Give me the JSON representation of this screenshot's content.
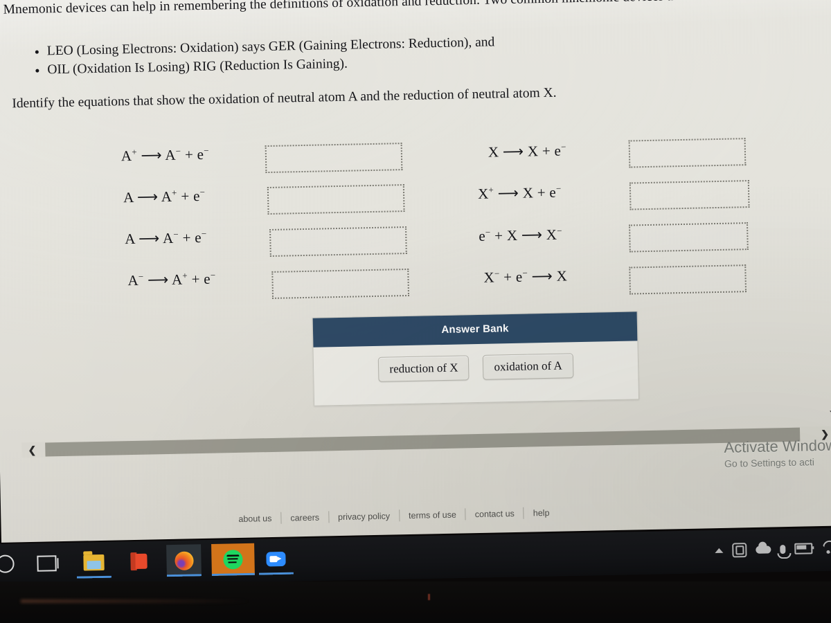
{
  "lesson": {
    "intro": "Mnemonic devices can help in remembering the definitions of oxidation and reduction. Two common mnemonic devices a",
    "bullets": [
      "LEO (Losing Electrons: Oxidation) says GER (Gaining Electrons: Reduction), and",
      "OIL (Oxidation Is Losing) RIG (Reduction Is Gaining)."
    ],
    "instruction": "Identify the equations that show the oxidation of neutral atom A and the reduction of neutral atom X."
  },
  "equations": {
    "left_column": [
      {
        "id": "eq-a1",
        "text": "A⁺ ⟶ A⁻ + e⁻",
        "drop_value": ""
      },
      {
        "id": "eq-a2",
        "text": "A ⟶ A⁺ + e⁻",
        "drop_value": ""
      },
      {
        "id": "eq-a3",
        "text": "A ⟶ A⁻ + e⁻",
        "drop_value": ""
      },
      {
        "id": "eq-a4",
        "text": "A⁻ ⟶ A⁺ + e⁻",
        "drop_value": ""
      }
    ],
    "right_column": [
      {
        "id": "eq-x1",
        "text": "X ⟶ X + e⁻",
        "drop_value": ""
      },
      {
        "id": "eq-x2",
        "text": "X⁺ ⟶ X + e⁻",
        "drop_value": ""
      },
      {
        "id": "eq-x3",
        "text": "e⁻ + X ⟶ X⁻",
        "drop_value": ""
      },
      {
        "id": "eq-x4",
        "text": "X⁻ + e⁻ ⟶ X",
        "drop_value": ""
      }
    ]
  },
  "answer_bank": {
    "title": "Answer Bank",
    "header_color": "#2e4a66",
    "tiles": [
      {
        "label": "reduction of X"
      },
      {
        "label": "oxidation of A"
      }
    ]
  },
  "scrollbars": {
    "left_arrow": "❮",
    "right_arrow": "❯",
    "down_chevron": "⌄"
  },
  "watermark": {
    "line1": "Activate Window",
    "line2": "Go to Settings to acti"
  },
  "footer": {
    "links": [
      "about us",
      "careers",
      "privacy policy",
      "terms of use",
      "contact us",
      "help"
    ]
  },
  "taskbar": {
    "items": [
      {
        "name": "cortana-icon",
        "icon": "ic-cortana",
        "active": false
      },
      {
        "name": "task-view-icon",
        "icon": "ic-taskview",
        "active": false
      },
      {
        "name": "file-explorer-icon",
        "icon": "ic-folder",
        "active": true
      },
      {
        "name": "office-icon",
        "icon": "ic-office",
        "active": false
      },
      {
        "name": "firefox-icon",
        "icon": "ic-firefox",
        "active": true
      },
      {
        "name": "spotify-icon",
        "icon": "ic-spotify",
        "active": true
      },
      {
        "name": "zoom-icon",
        "icon": "ic-zoom",
        "active": true
      }
    ],
    "tray": [
      {
        "name": "show-hidden-icons-icon",
        "icon": "ic-chevup"
      },
      {
        "name": "teams-icon",
        "icon": "ic-teams"
      },
      {
        "name": "onedrive-cloud-icon",
        "icon": "ic-cloud"
      },
      {
        "name": "microphone-icon",
        "icon": "ic-mic"
      },
      {
        "name": "battery-icon",
        "icon": "ic-battery"
      },
      {
        "name": "wifi-icon",
        "icon": "ic-wifi"
      }
    ]
  }
}
